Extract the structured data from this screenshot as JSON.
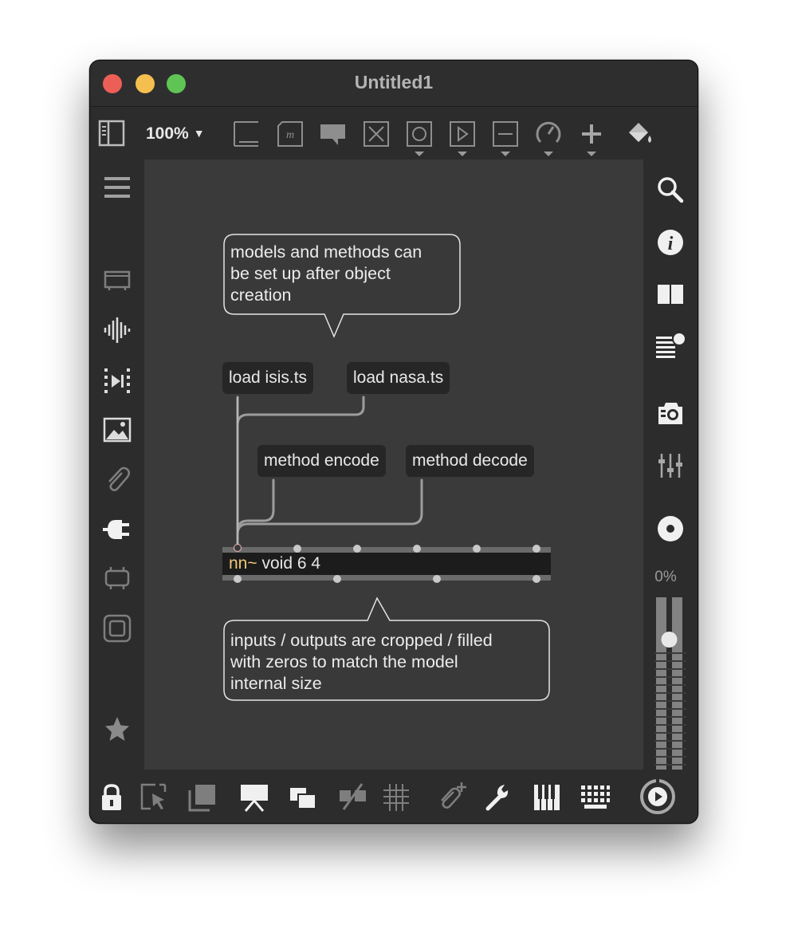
{
  "window": {
    "title": "Untitled1"
  },
  "toolbar": {
    "zoom": "100%",
    "icons": [
      "sidebar-toggle-icon",
      "presentation-icon",
      "message-icon",
      "comment-icon",
      "object-icon",
      "toggle-icon",
      "play-icon",
      "number-icon",
      "dial-icon",
      "add-icon",
      "paint-bucket-icon"
    ]
  },
  "left_sidebar": {
    "icons": [
      "menu-icon",
      "browser-icon",
      "audio-icon",
      "video-icon",
      "image-icon",
      "clip-icon",
      "plugin-icon",
      "device-icon",
      "frame-icon",
      "favorites-icon"
    ]
  },
  "right_sidebar": {
    "icons": [
      "search-icon",
      "info-icon",
      "reference-icon",
      "console-list-icon",
      "snapshot-icon",
      "mixer-icon",
      "dsp-icon"
    ],
    "level_label": "0%"
  },
  "patch": {
    "comment_top": [
      "models and methods can",
      "be set up after object",
      "creation"
    ],
    "msg_load_isis": "load isis.ts",
    "msg_load_nasa": "load nasa.ts",
    "msg_method_encode": "method encode",
    "msg_method_decode": "method decode",
    "nn_object": {
      "name": "nn~",
      "args": "void 6 4"
    },
    "comment_bottom": [
      "inputs / outputs are cropped / filled",
      "with zeros to match the model",
      "internal size"
    ]
  },
  "bottombar": {
    "icons": [
      "lock-icon",
      "select-icon",
      "layers-icon",
      "presentation-mode-icon",
      "windows-icon",
      "patch-cords-hidden-icon",
      "grid-icon",
      "attach-icon",
      "wrench-icon",
      "piano-icon",
      "keyboard-icon",
      "audio-on-icon"
    ]
  },
  "colors": {
    "background": "#3a3a3b",
    "chrome": "#2c2c2d",
    "accent_object_name": "#f0c778"
  }
}
